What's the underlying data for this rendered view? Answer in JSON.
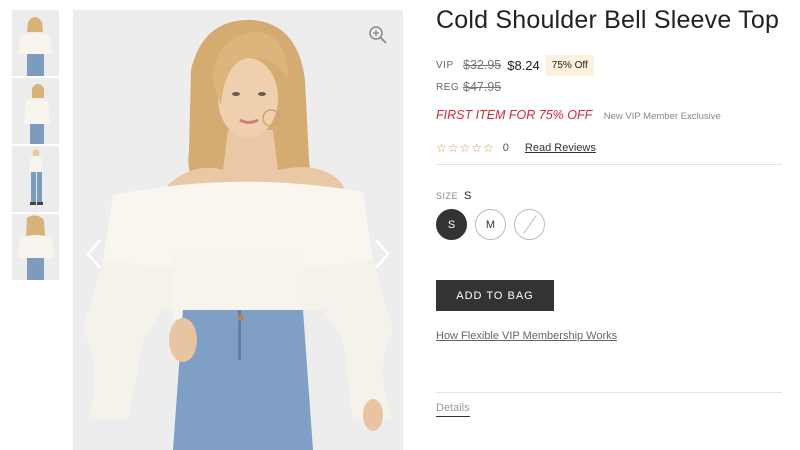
{
  "product": {
    "title": "Cold Shoulder Bell Sleeve Top",
    "vip_label": "VIP",
    "vip_original_price": "$32.95",
    "vip_price": "$8.24",
    "discount_badge": "75% Off",
    "reg_label": "REG",
    "reg_price": "$47.95",
    "promo_text": "FIRST ITEM FOR 75% OFF",
    "promo_subtext": "New VIP Member Exclusive",
    "rating_stars": "☆☆☆☆☆",
    "review_count": "0",
    "reviews_link": "Read Reviews"
  },
  "size_selector": {
    "label": "SIZE",
    "selected": "S",
    "options": [
      "S",
      "M",
      ""
    ]
  },
  "actions": {
    "add_to_bag": "ADD TO BAG",
    "vip_info_link": "How Flexible VIP Membership Works",
    "details_tab": "Details"
  },
  "gallery": {
    "thumbnail_count": 4,
    "active_index": 0
  },
  "colors": {
    "promo_red": "#d6263a",
    "badge_bg": "#fdf0dc",
    "button_dark": "#333333",
    "star_gold": "#c9a04a"
  }
}
